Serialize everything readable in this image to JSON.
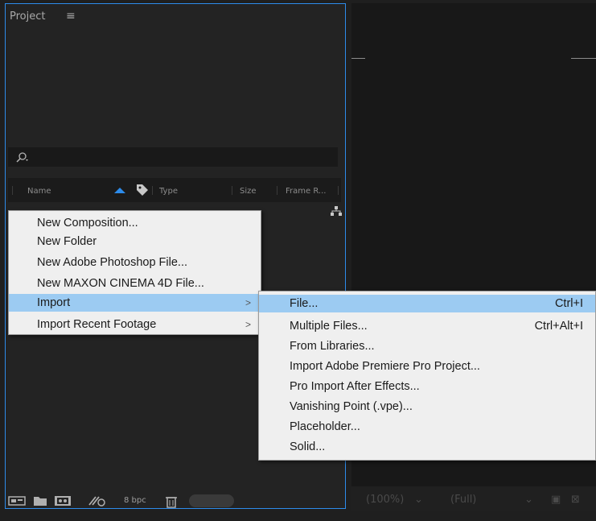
{
  "project_panel": {
    "title": "Project",
    "menu_icon": "hamburger-icon",
    "search_placeholder": "",
    "columns": [
      "Name",
      "Type",
      "Size",
      "Frame R..."
    ]
  },
  "bottom_toolbar": {
    "bpc_label": "8 bpc"
  },
  "viewer_controls": {
    "zoom": "(100%)",
    "resolution": "(Full)"
  },
  "context_menu": {
    "items": [
      {
        "label": "New Composition..."
      },
      {
        "label": "New Folder"
      },
      {
        "label": "New Adobe Photoshop File..."
      },
      {
        "label": "New MAXON CINEMA 4D File..."
      },
      {
        "label": "Import",
        "arrow": ">",
        "selected": true
      },
      {
        "label": "Import Recent Footage",
        "arrow": ">"
      }
    ]
  },
  "import_submenu": {
    "items": [
      {
        "label": "File...",
        "shortcut": "Ctrl+I",
        "selected": true
      },
      {
        "label": "Multiple Files...",
        "shortcut": "Ctrl+Alt+I"
      },
      {
        "label": "From Libraries..."
      },
      {
        "label": "Import Adobe Premiere Pro Project..."
      },
      {
        "label": "Pro Import After Effects..."
      },
      {
        "label": "Vanishing Point (.vpe)..."
      },
      {
        "label": "Placeholder..."
      },
      {
        "label": "Solid..."
      }
    ]
  },
  "colors": {
    "selection": "#9ccbf2",
    "panel_border": "#2d8ceb",
    "sort_arrow": "#2d8ceb"
  }
}
